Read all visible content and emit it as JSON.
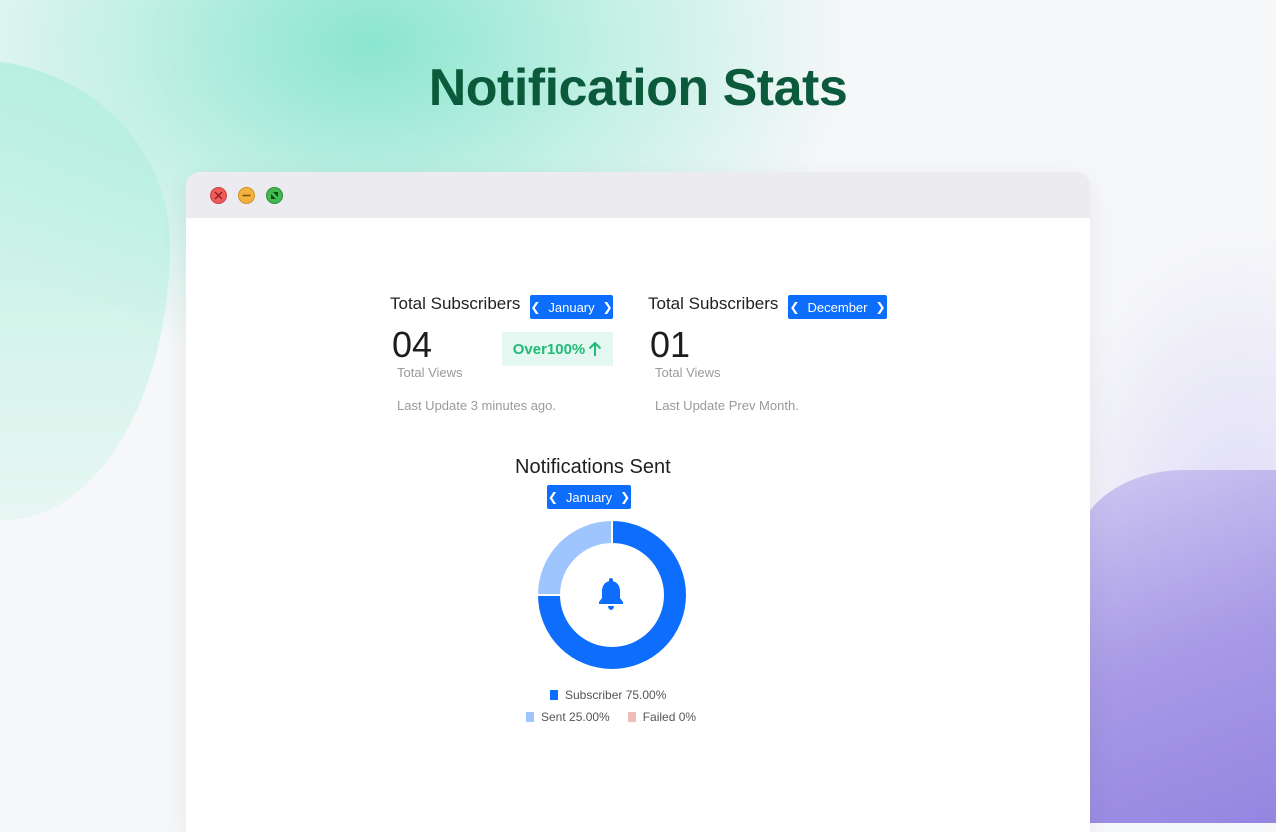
{
  "page": {
    "title": "Notification Stats"
  },
  "window_controls": {
    "close": "close",
    "minimize": "minimize",
    "maximize": "maximize"
  },
  "stats": [
    {
      "title": "Total Subscribers",
      "month": "January",
      "value": "04",
      "label": "Total Views",
      "updated": "Last Update 3 minutes ago.",
      "badge": "Over100%"
    },
    {
      "title": "Total Subscribers",
      "month": "December",
      "value": "01",
      "label": "Total Views",
      "updated": "Last Update Prev Month."
    }
  ],
  "notifications": {
    "title": "Notifications Sent",
    "month": "January"
  },
  "chart_data": {
    "type": "pie",
    "donut": true,
    "center_icon": "bell-icon",
    "series": [
      {
        "name": "Subscriber",
        "label": "Subscriber 75.00%",
        "value": 75,
        "color": "#0d6efd"
      },
      {
        "name": "Sent",
        "label": "Sent 25.00%",
        "value": 25,
        "color": "#9ec5fe"
      },
      {
        "name": "Failed",
        "label": "Failed 0%",
        "value": 0,
        "color": "#f1bcbc"
      }
    ]
  },
  "colors": {
    "accent": "#0d6efd",
    "title": "#0b5a3b",
    "badge_text": "#1fbb77",
    "badge_bg": "#e4f7f0"
  }
}
